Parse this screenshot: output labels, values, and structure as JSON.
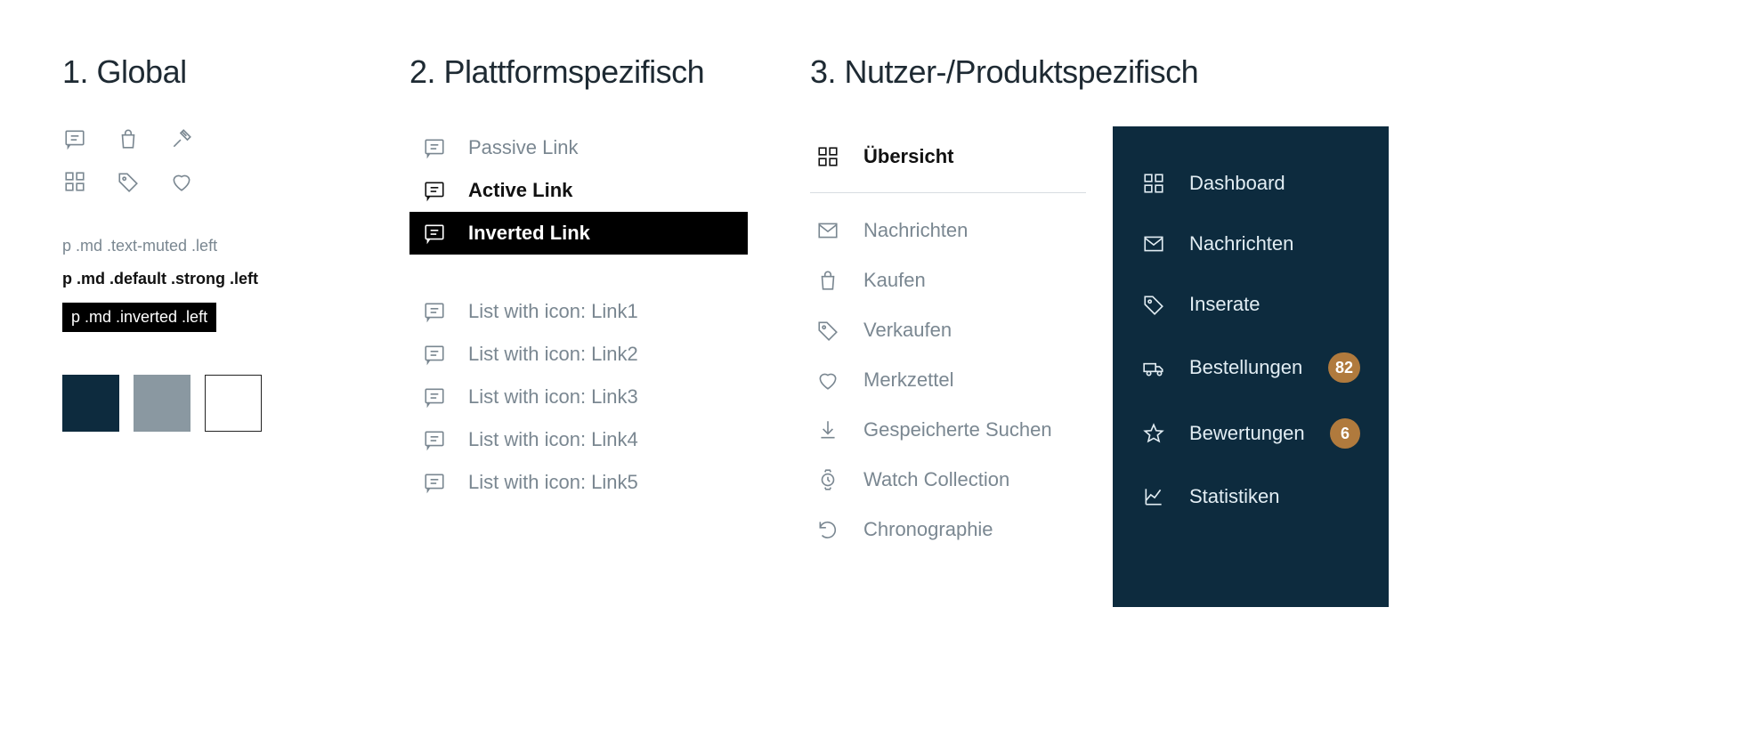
{
  "sections": {
    "global": {
      "title": "1. Global"
    },
    "platform": {
      "title": "2. Plattformspezifisch"
    },
    "user": {
      "title": "3. Nutzer-/Produktspezifisch"
    }
  },
  "global_icons": [
    "message",
    "bag",
    "gavel",
    "dashboard",
    "tag",
    "heart"
  ],
  "text_specs": {
    "muted": "p .md .text-muted .left",
    "strong": "p .md .default .strong .left",
    "inverted": "p .md .inverted .left"
  },
  "swatches": {
    "dark": "#0d2b3e",
    "gray": "#8a98a1",
    "white": "#ffffff"
  },
  "platform_links": {
    "passive": "Passive Link",
    "active": "Active Link",
    "inverted": "Inverted Link",
    "list": [
      "List with icon: Link1",
      "List with icon: Link2",
      "List with icon: Link3",
      "List with icon: Link4",
      "List with icon: Link5"
    ]
  },
  "light_nav": {
    "top": "Übersicht",
    "items": [
      {
        "icon": "mail",
        "label": "Nachrichten"
      },
      {
        "icon": "bag",
        "label": "Kaufen"
      },
      {
        "icon": "tag",
        "label": "Verkaufen"
      },
      {
        "icon": "heart",
        "label": "Merkzettel"
      },
      {
        "icon": "download",
        "label": "Gespeicherte Suchen"
      },
      {
        "icon": "watch",
        "label": "Watch Collection"
      },
      {
        "icon": "undo",
        "label": "Chronographie"
      }
    ]
  },
  "dark_nav": {
    "items": [
      {
        "icon": "dashboard",
        "label": "Dashboard"
      },
      {
        "icon": "mail",
        "label": "Nachrichten"
      },
      {
        "icon": "tag",
        "label": "Inserate"
      },
      {
        "icon": "truck",
        "label": "Bestellungen",
        "badge": "82"
      },
      {
        "icon": "star",
        "label": "Bewertungen",
        "badge": "6"
      },
      {
        "icon": "chart",
        "label": "Statistiken"
      }
    ]
  }
}
